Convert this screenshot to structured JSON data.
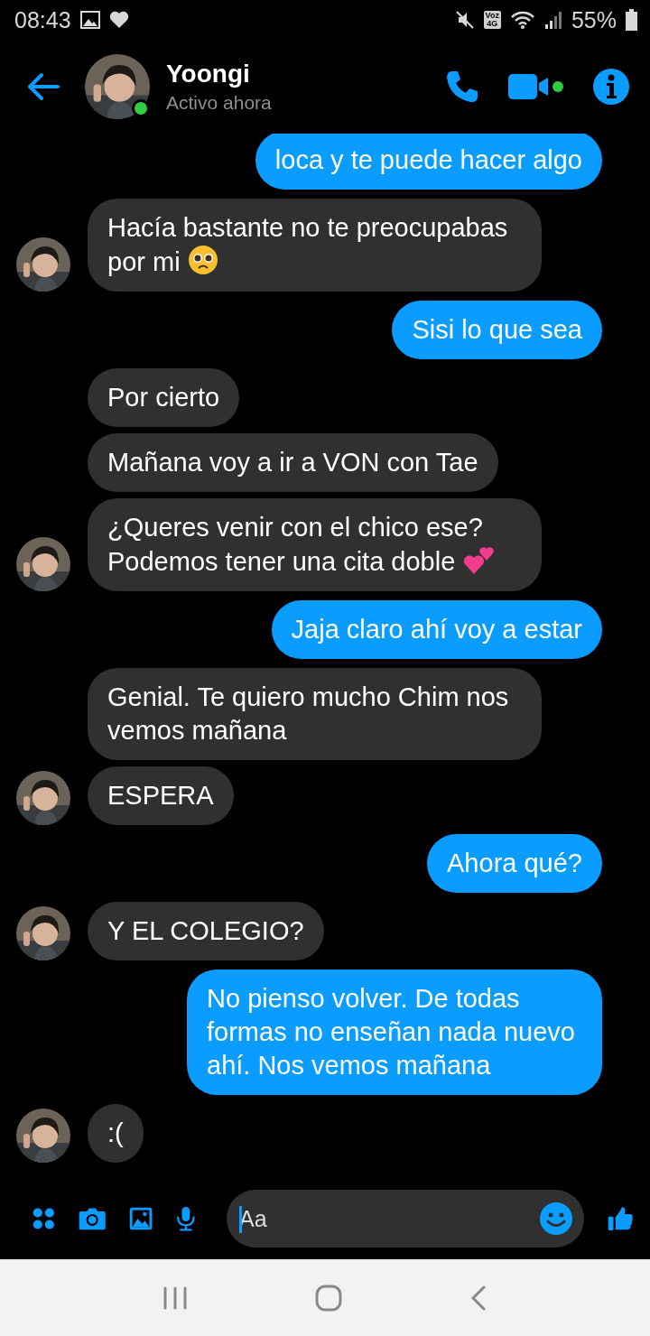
{
  "status_bar": {
    "time": "08:43",
    "network_badge": "Voz\n4G",
    "battery": "55%"
  },
  "header": {
    "name": "Yoongi",
    "subtitle": "Activo ahora",
    "active": true,
    "video_active": true
  },
  "messages": [
    {
      "kind": "sent",
      "text": "loca y te puede hacer algo",
      "avatar": false
    },
    {
      "kind": "received",
      "text": "Hacía bastante no te preocupabas por mi",
      "pleading_emoji": true,
      "avatar": true
    },
    {
      "kind": "sent",
      "text": "Sisi lo que sea",
      "avatar": false
    },
    {
      "kind": "received",
      "text": "Por cierto",
      "avatar": false
    },
    {
      "kind": "received",
      "text": "Mañana voy a ir a VON con Tae",
      "avatar": false
    },
    {
      "kind": "received",
      "text": "¿Queres venir con el chico ese? Podemos tener una cita doble",
      "hearts_emoji": true,
      "avatar": true
    },
    {
      "kind": "sent",
      "text": "Jaja claro ahí voy a estar",
      "avatar": false
    },
    {
      "kind": "received",
      "text": "Genial. Te quiero mucho Chim nos vemos mañana",
      "avatar": false
    },
    {
      "kind": "received",
      "text": "ESPERA",
      "avatar": true
    },
    {
      "kind": "sent",
      "text": "Ahora qué?",
      "avatar": false
    },
    {
      "kind": "received",
      "text": "Y EL COLEGIO?",
      "avatar": true
    },
    {
      "kind": "sent",
      "text": "No pienso volver. De todas formas no enseñan nada nuevo ahí. Nos vemos mañana",
      "avatar": false
    },
    {
      "kind": "received",
      "text": ":(",
      "avatar": true
    }
  ],
  "composer": {
    "placeholder": "Aa"
  }
}
